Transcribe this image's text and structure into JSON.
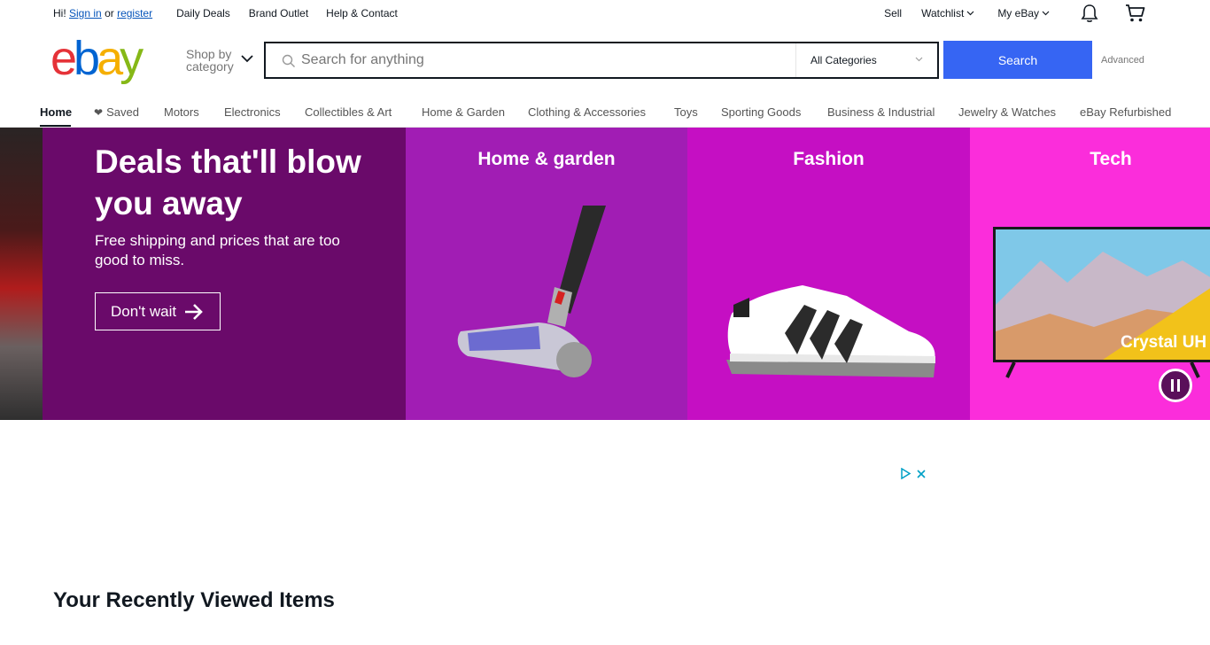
{
  "topbar": {
    "greeting_prefix": "Hi!",
    "sign_in": "Sign in",
    "or": "or",
    "register": "register",
    "links": [
      "Daily Deals",
      "Brand Outlet",
      "Help & Contact"
    ],
    "sell": "Sell",
    "watchlist": "Watchlist",
    "my_ebay": "My eBay",
    "notification_icon": "bell-icon",
    "cart_icon": "cart-icon"
  },
  "header": {
    "logo": {
      "e": "e",
      "b": "b",
      "a": "a",
      "y": "y"
    },
    "shop_by_category": "Shop by category",
    "search_placeholder": "Search for anything",
    "category_select": "All Categories",
    "search_button": "Search",
    "advanced": "Advanced"
  },
  "nav": {
    "items": [
      "Home",
      "Saved",
      "Motors",
      "Electronics",
      "Collectibles & Art",
      "Home & Garden",
      "Clothing & Accessories",
      "Toys",
      "Sporting Goods",
      "Business & Industrial",
      "Jewelry & Watches",
      "eBay Refurbished"
    ],
    "active": "Home"
  },
  "hero": {
    "headline": "Deals that'll blow you away",
    "subtext": "Free shipping and prices that are too good to miss.",
    "cta": "Don't wait",
    "panels": [
      "Home & garden",
      "Fashion",
      "Tech"
    ],
    "tv_label": "Crystal UH",
    "colors": {
      "main": "#6a0a6a",
      "home": "#a11db4",
      "fashion": "#c50fc3",
      "tech": "#fb2ddb"
    }
  },
  "recently_viewed_title": "Your Recently Viewed Items",
  "colors": {
    "search_button": "#3665f3",
    "link": "#0654ba"
  }
}
